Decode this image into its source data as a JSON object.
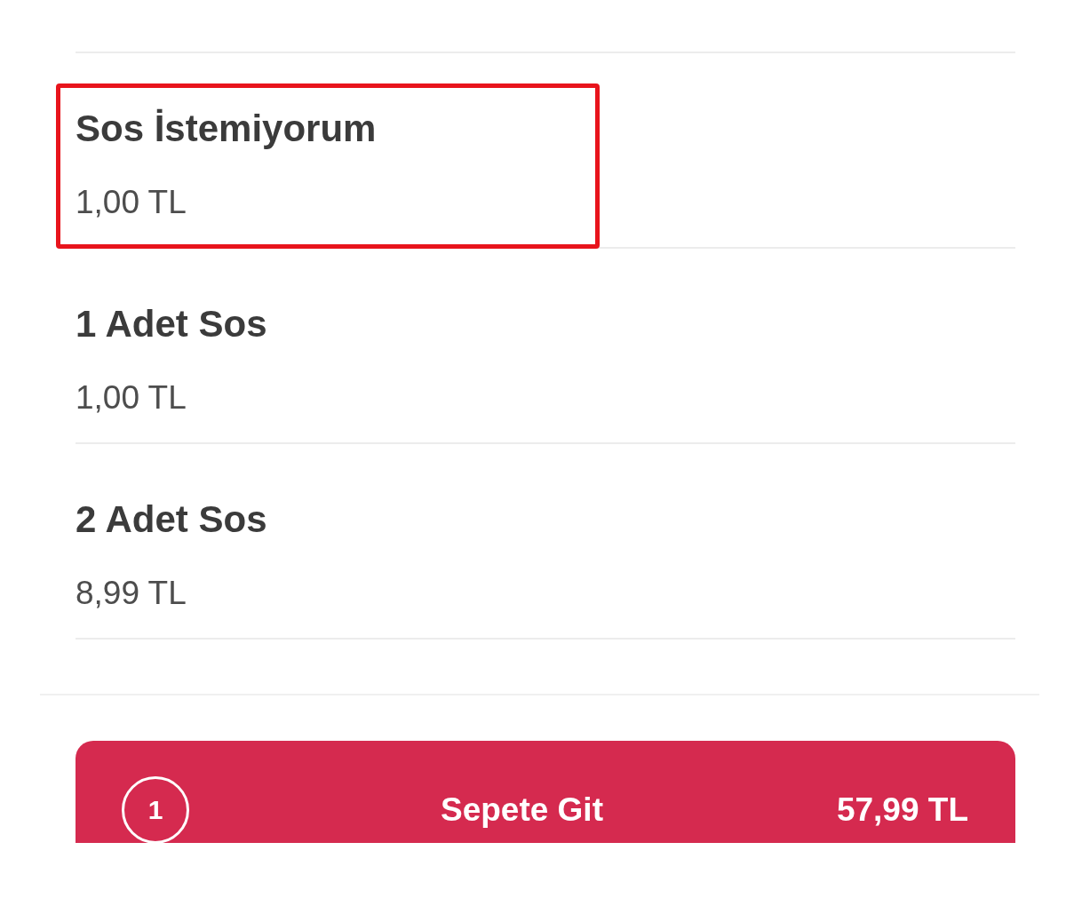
{
  "options": [
    {
      "name": "Sos İstemiyorum",
      "price": "1,00 TL",
      "highlighted": true
    },
    {
      "name": "1 Adet Sos",
      "price": "1,00 TL",
      "highlighted": false
    },
    {
      "name": "2 Adet Sos",
      "price": "8,99 TL",
      "highlighted": false
    }
  ],
  "cart_button": {
    "count": "1",
    "label": "Sepete Git",
    "total": "57,99 TL"
  }
}
